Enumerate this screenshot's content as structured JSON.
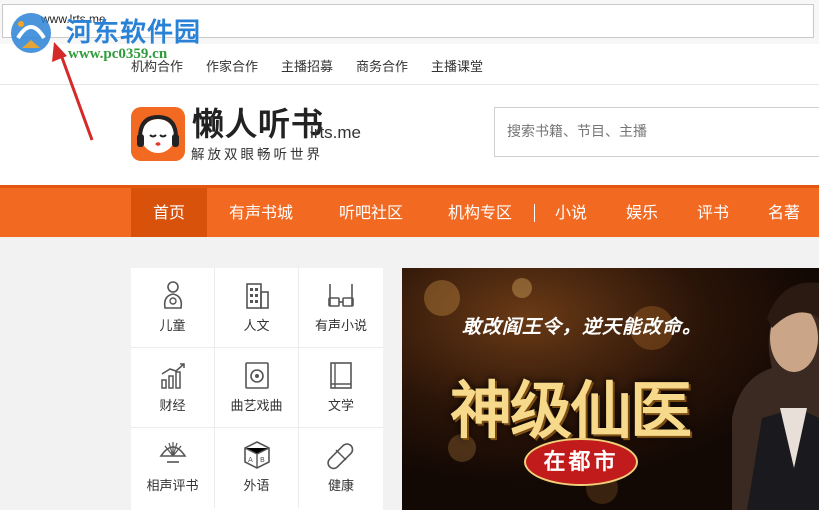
{
  "browser": {
    "address": "www.lrts.me"
  },
  "watermark": {
    "name_cn": "河东软件园",
    "url": "www.pc0359.cn"
  },
  "top_links": [
    {
      "label": "机构合作"
    },
    {
      "label": "作家合作"
    },
    {
      "label": "主播招募"
    },
    {
      "label": "商务合作"
    },
    {
      "label": "主播课堂"
    }
  ],
  "header": {
    "logo_title": "懒人听书",
    "logo_domain": "lrts.me",
    "logo_slogan": "解放双眼畅听世界",
    "search_placeholder": "搜索书籍、节目、主播"
  },
  "nav": {
    "items": [
      {
        "label": "首页",
        "active": true
      },
      {
        "label": "有声书城"
      },
      {
        "label": "听吧社区"
      },
      {
        "label": "机构专区"
      },
      {
        "label": "小说"
      },
      {
        "label": "娱乐"
      },
      {
        "label": "评书"
      },
      {
        "label": "名著"
      }
    ]
  },
  "categories": [
    {
      "label": "儿童",
      "icon": "baby-icon"
    },
    {
      "label": "人文",
      "icon": "building-icon"
    },
    {
      "label": "有声小说",
      "icon": "glasses-icon"
    },
    {
      "label": "财经",
      "icon": "bar-chart-icon"
    },
    {
      "label": "曲艺戏曲",
      "icon": "speaker-icon"
    },
    {
      "label": "文学",
      "icon": "book-icon"
    },
    {
      "label": "相声评书",
      "icon": "fan-icon"
    },
    {
      "label": "外语",
      "icon": "abc-cube-icon"
    },
    {
      "label": "健康",
      "icon": "pill-icon"
    }
  ],
  "banner": {
    "slogan": "敢改阎王令，逆天能改命。",
    "title": "神级仙医",
    "subtitle": "在都市"
  },
  "colors": {
    "brand_orange": "#f26a22",
    "nav_active": "#d9520c",
    "watermark_blue": "#2a82d6",
    "watermark_green": "#2e9c3b"
  }
}
